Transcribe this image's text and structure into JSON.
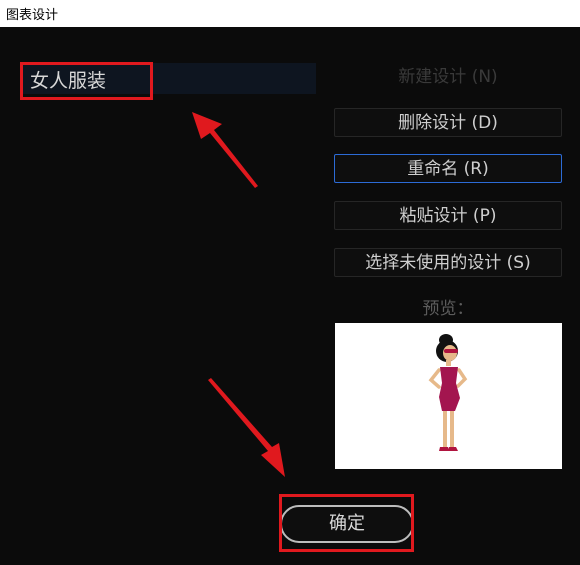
{
  "window": {
    "title": "图表设计"
  },
  "design_list": {
    "items": [
      "女人服装"
    ]
  },
  "buttons": {
    "new": "新建设计 (N)",
    "delete": "删除设计 (D)",
    "rename": "重命名 (R)",
    "paste": "粘贴设计 (P)",
    "select_unused": "选择未使用的设计 (S)"
  },
  "preview": {
    "label": "预览："
  },
  "ok_button": "确定",
  "colors": {
    "highlight": "#e0191e",
    "focus": "#2c6bd6",
    "dress": "#a3154f"
  }
}
